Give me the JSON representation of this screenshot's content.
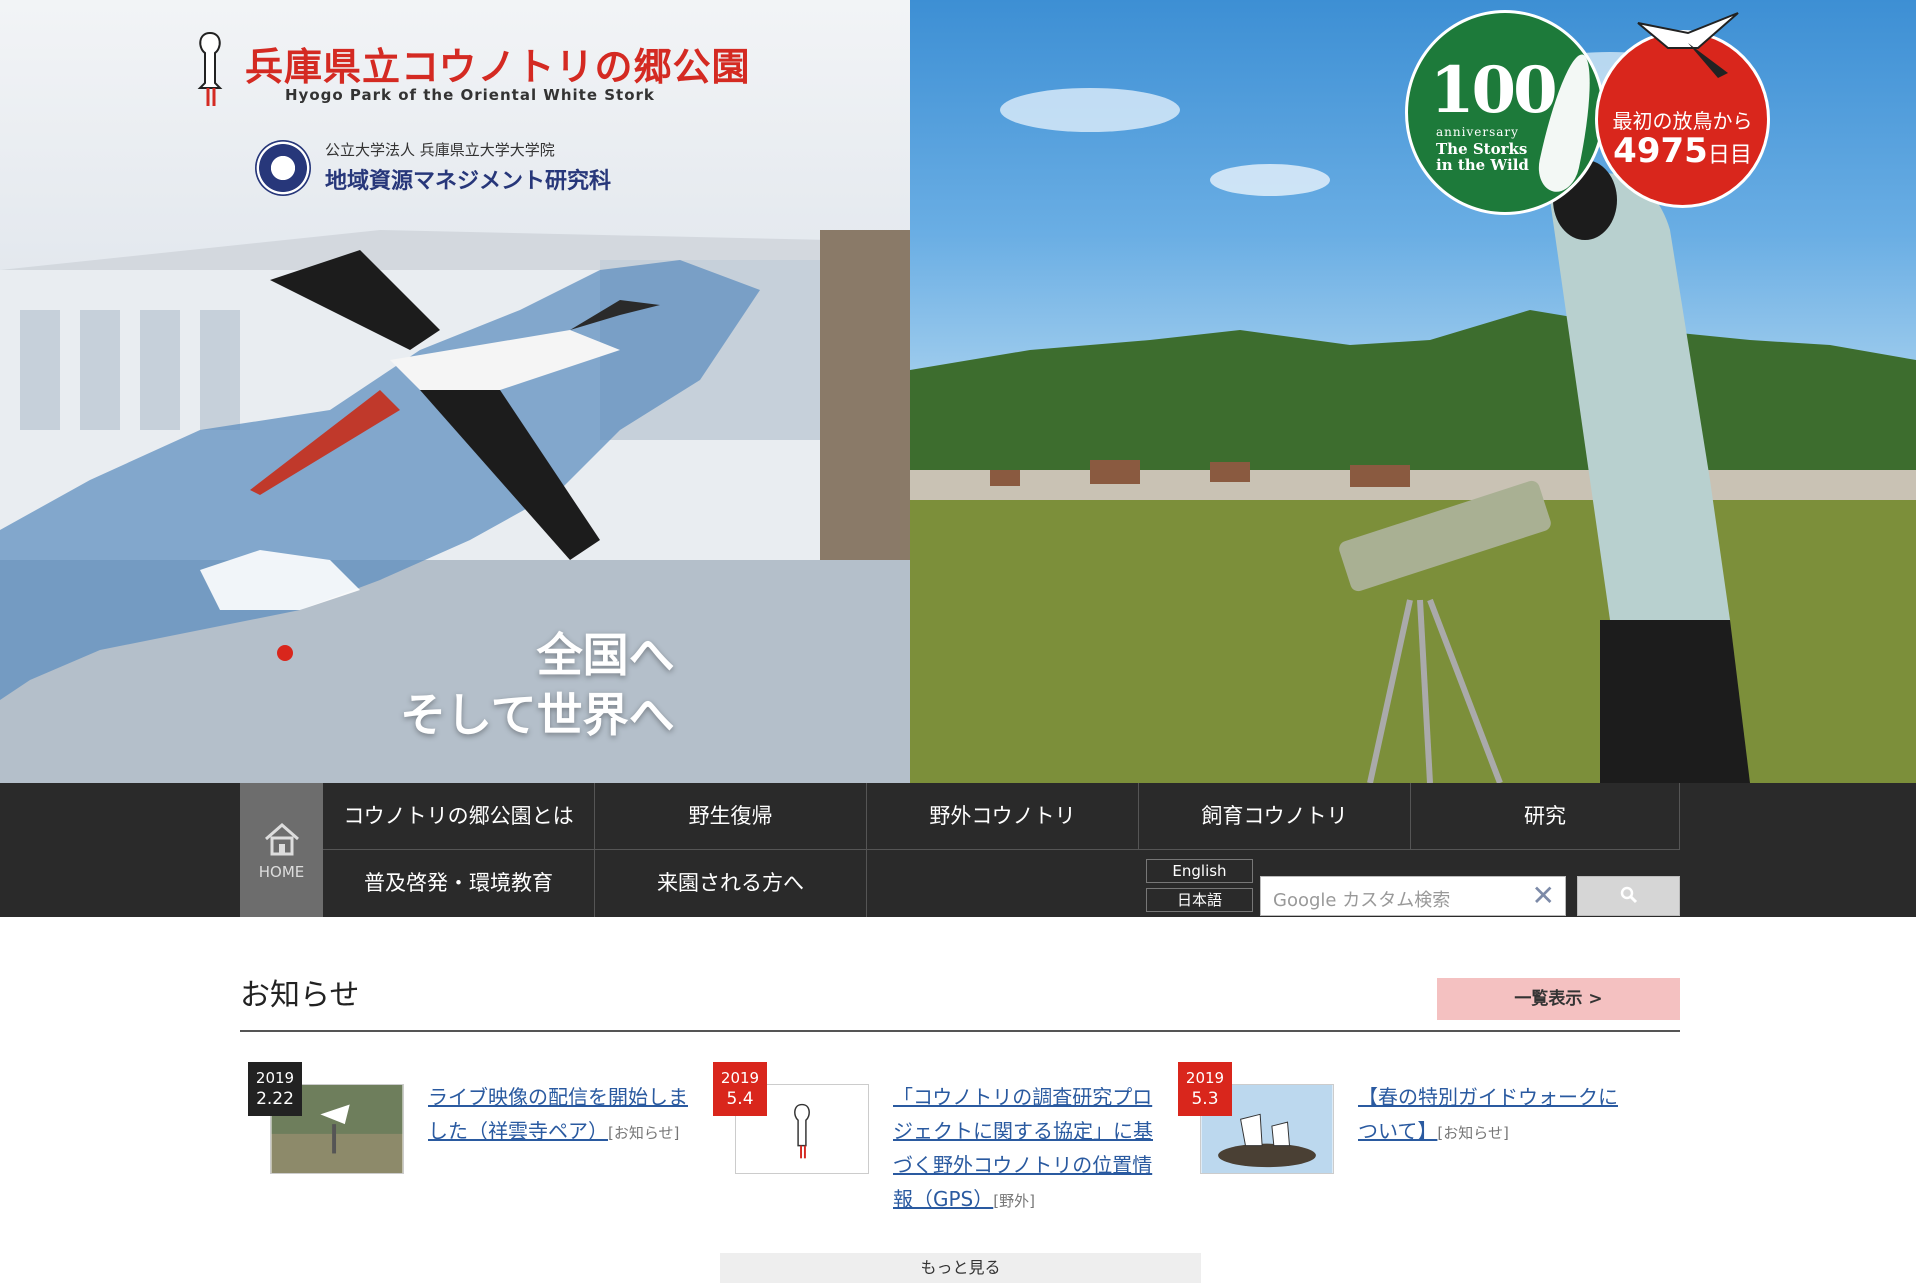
{
  "header": {
    "logo_title": "兵庫県立コウノトリの郷公園",
    "logo_subtitle": "Hyogo Park of the Oriental White Stork",
    "university_line1": "公立大学法人 兵庫県立大学大学院",
    "university_line2": "地域資源マネジメント研究科",
    "slogan_line1": "全国へ",
    "slogan_line2": "そして世界へ"
  },
  "badges": {
    "anniversary_number": "100",
    "anniversary_word": "anniversary",
    "anniversary_line1": "The Storks",
    "anniversary_line2": "in the Wild",
    "release_label": "最初の放鳥から",
    "release_days": "4975",
    "release_unit": "日目"
  },
  "nav": {
    "home_label": "HOME",
    "items_row1": [
      "コウノトリの郷公園とは",
      "野生復帰",
      "野外コウノトリ",
      "飼育コウノトリ",
      "研究"
    ],
    "items_row2": [
      "普及啓発・環境教育",
      "来園される方へ"
    ],
    "lang_english": "English",
    "lang_japanese": "日本語",
    "search_google": "Google",
    "search_placeholder": "カスタム検索",
    "search_clear": "✕"
  },
  "news": {
    "title": "お知らせ",
    "list_button": "一覧表示 >",
    "items": [
      {
        "year": "2019",
        "date": "2.22",
        "title": "ライブ映像の配信を開始しました（祥雲寺ペア）",
        "category": "[お知らせ]",
        "badge_color": "#222222"
      },
      {
        "year": "2019",
        "date": "5.4",
        "title": "「コウノトリの調査研究プロジェクトに関する協定」に基づく野外コウノトリの位置情報（GPS）",
        "category": "[野外]",
        "badge_color": "#d9261c"
      },
      {
        "year": "2019",
        "date": "5.3",
        "title": "【春の特別ガイドウォークについて】",
        "category": "[お知らせ]",
        "badge_color": "#d9261c"
      }
    ],
    "more_label": "もっと見る"
  },
  "colors": {
    "brand_red": "#d42a22",
    "nav_bg": "#2a2a2a",
    "link": "#2a5aa0",
    "badge_pink": "#f4c1c1"
  }
}
